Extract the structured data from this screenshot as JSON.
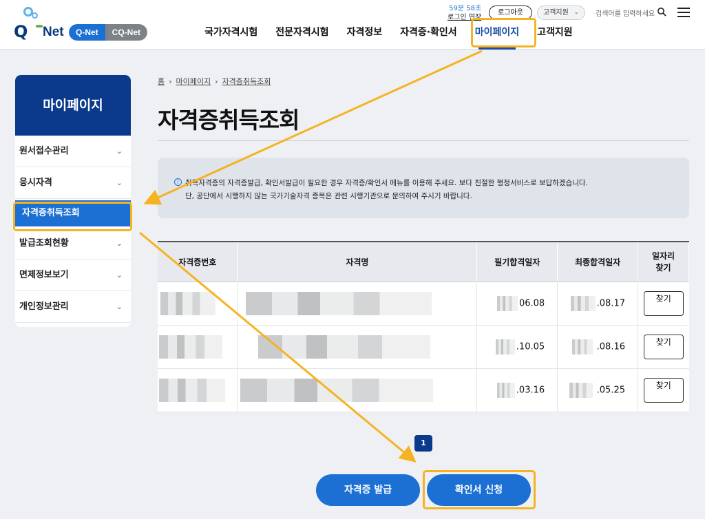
{
  "header": {
    "logo_text": "Q-Net",
    "sites": [
      "Q-Net",
      "CQ-Net"
    ],
    "session_timer": "59분 58초",
    "session_extend": "로그인 연장",
    "logout_label": "로그아웃",
    "support_label": "고객지원",
    "search_placeholder": "검색어를 입력하세요",
    "nav": [
      "국가자격시험",
      "전문자격시험",
      "자격정보",
      "자격증·확인서",
      "마이페이지",
      "고객지원"
    ]
  },
  "sidebar": {
    "title": "마이페이지",
    "items": [
      "원서접수관리",
      "응시자격",
      "자격증취득조회",
      "발급조회현황",
      "면제정보보기",
      "개인정보관리"
    ]
  },
  "breadcrumb": [
    "홈",
    "마이페이지",
    "자격증취득조회"
  ],
  "page_title": "자격증취득조회",
  "notice": {
    "line1": "취득자격증의 자격증발급, 확인서발급이 필요한 경우 자격증/확인서 메뉴를 이용해 주세요. 보다 친절한 행정서비스로 보답하겠습니다.",
    "line2": "단, 공단에서 시행하지 않는 국가기술자격 종목은 관련 시행기관으로 문의하여 주시기 바랍니다."
  },
  "table": {
    "headers": [
      "자격증번호",
      "자격명",
      "필기합격일자",
      "최종합격일자",
      "일자리 찾기"
    ],
    "rows": [
      {
        "written_date": "06.08",
        "final_date": ".08.17",
        "button": "찾기"
      },
      {
        "written_date": ".10.05",
        "final_date": ".08.16",
        "button": "찾기"
      },
      {
        "written_date": ".03.16",
        "final_date": ".05.25",
        "button": "찾기"
      }
    ]
  },
  "pagination": {
    "current": "1"
  },
  "actions": {
    "issue_label": "자격증 발급",
    "confirm_label": "확인서 신청"
  },
  "colors": {
    "highlight": "#f5b321",
    "primary": "#1c6fd3",
    "navy": "#0b3a8c"
  }
}
